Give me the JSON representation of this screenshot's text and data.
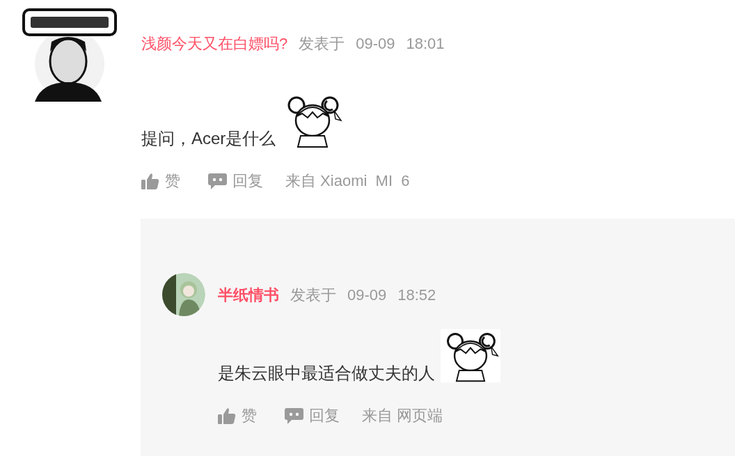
{
  "comment": {
    "author": "浅颜今天又在白嫖吗?",
    "author_bold": false,
    "posted_label": "发表于",
    "date": "09-09",
    "time": "18:01",
    "body": "提问，Acer是什么",
    "like": "赞",
    "reply": "回复",
    "source": "来自 Xiaomi  MI  6"
  },
  "reply": {
    "author": "半纸情书",
    "author_bold": true,
    "posted_label": "发表于",
    "date": "09-09",
    "time": "18:52",
    "body": "是朱云眼中最适合做丈夫的人",
    "like": "赞",
    "reply": "回复",
    "source": "来自 网页端"
  }
}
